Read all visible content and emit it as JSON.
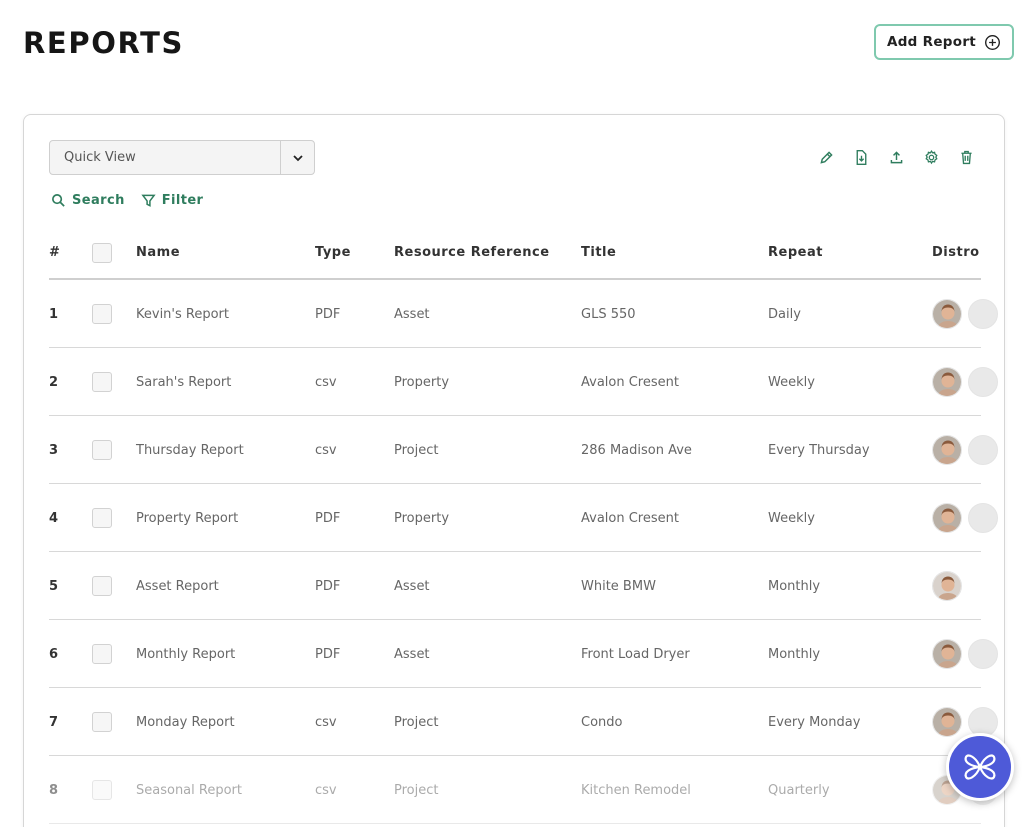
{
  "header": {
    "title": "REPORTS",
    "add_report_label": "Add Report"
  },
  "view": {
    "selected": "Quick View"
  },
  "toolbar": {
    "icons": [
      "edit-icon",
      "export-file-icon",
      "upload-icon",
      "settings-icon",
      "trash-icon"
    ]
  },
  "actions": {
    "search_label": "Search",
    "filter_label": "Filter"
  },
  "table": {
    "columns": {
      "num": "#",
      "name": "Name",
      "type": "Type",
      "ref": "Resource Reference",
      "title": "Title",
      "repeat": "Repeat",
      "distro": "Distro"
    },
    "rows": [
      {
        "num": "1",
        "name": "Kevin's Report",
        "type": "PDF",
        "ref": "Asset",
        "title": "GLS 550",
        "repeat": "Daily"
      },
      {
        "num": "2",
        "name": "Sarah's Report",
        "type": "csv",
        "ref": "Property",
        "title": "Avalon Cresent",
        "repeat": "Weekly"
      },
      {
        "num": "3",
        "name": "Thursday Report",
        "type": "csv",
        "ref": "Project",
        "title": "286 Madison Ave",
        "repeat": "Every Thursday"
      },
      {
        "num": "4",
        "name": "Property Report",
        "type": "PDF",
        "ref": "Property",
        "title": "Avalon Cresent",
        "repeat": "Weekly"
      },
      {
        "num": "5",
        "name": "Asset Report",
        "type": "PDF",
        "ref": "Asset",
        "title": "White BMW",
        "repeat": "Monthly"
      },
      {
        "num": "6",
        "name": "Monthly Report",
        "type": "PDF",
        "ref": "Asset",
        "title": "Front Load Dryer",
        "repeat": "Monthly"
      },
      {
        "num": "7",
        "name": "Monday Report",
        "type": "csv",
        "ref": "Project",
        "title": "Condo",
        "repeat": "Every Monday"
      },
      {
        "num": "8",
        "name": "Seasonal Report",
        "type": "csv",
        "ref": "Project",
        "title": "Kitchen Remodel",
        "repeat": "Quarterly"
      }
    ]
  },
  "colors": {
    "accent": "#2f7d5e",
    "button_border": "#7fc9ae",
    "fab": "#4e5ad8"
  }
}
